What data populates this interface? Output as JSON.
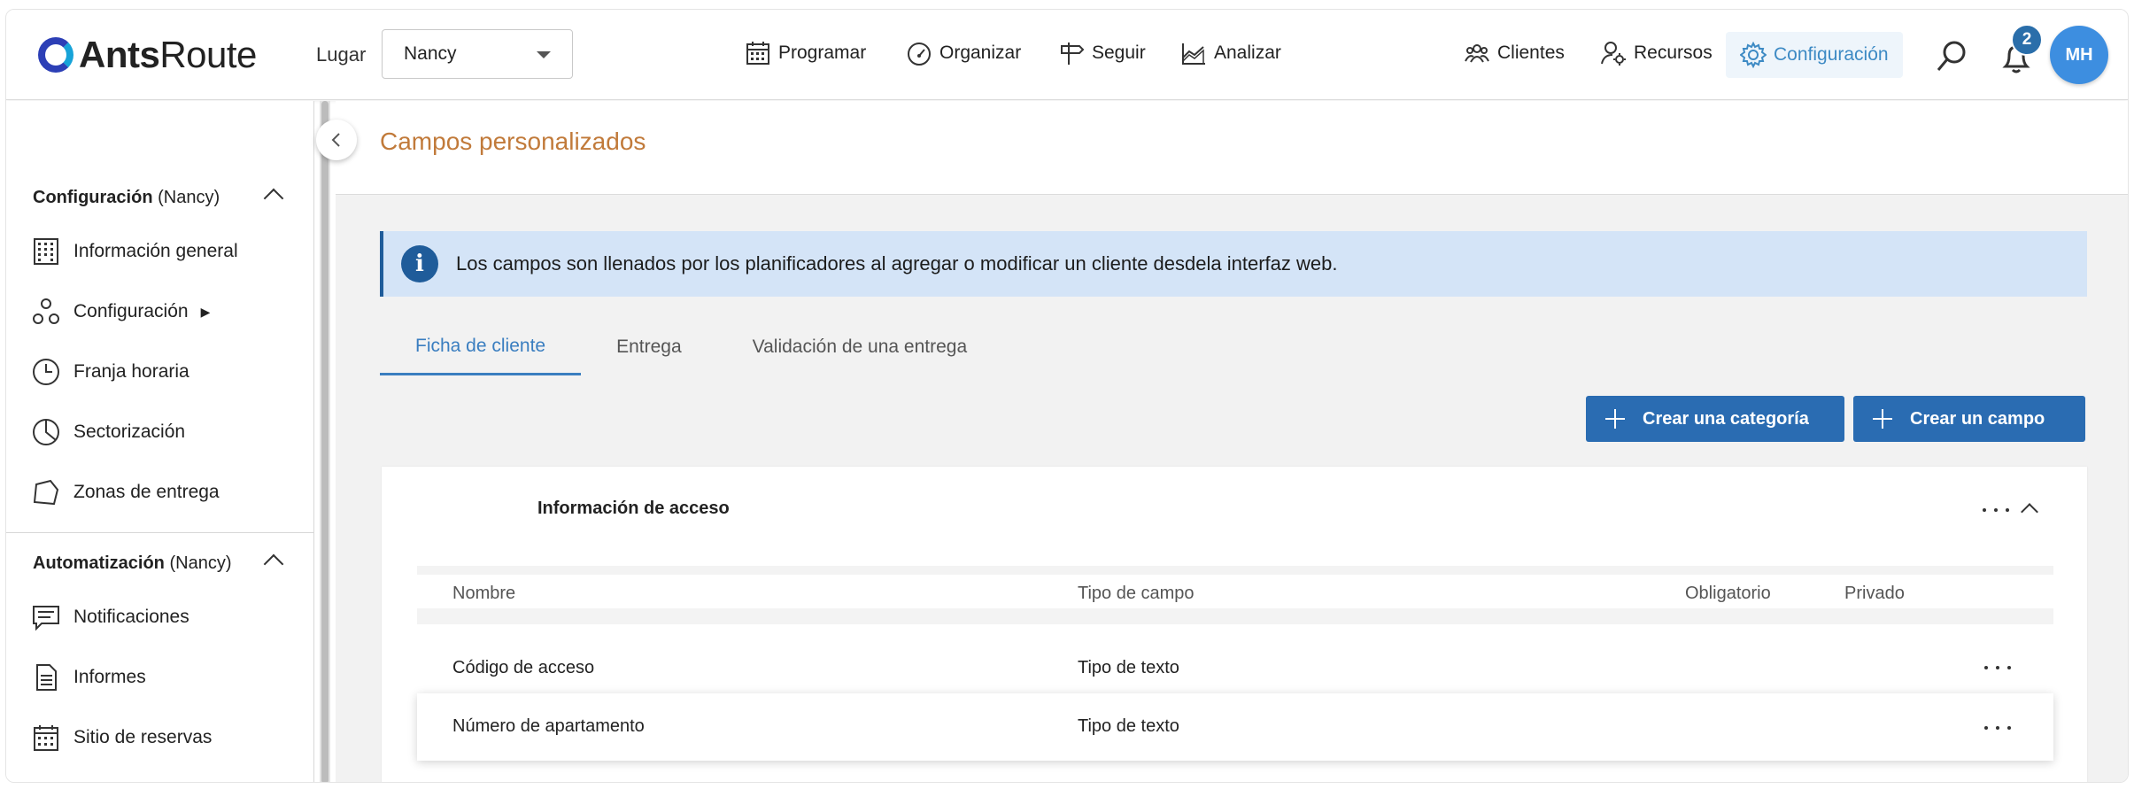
{
  "header": {
    "logo_bold": "Ants",
    "logo_regular": "Route",
    "lugar_label": "Lugar",
    "lugar_value": "Nancy",
    "nav": [
      {
        "label": "Programar",
        "icon": "calendar-icon"
      },
      {
        "label": "Organizar",
        "icon": "gauge-icon"
      },
      {
        "label": "Seguir",
        "icon": "signpost-icon"
      },
      {
        "label": "Analizar",
        "icon": "chart-icon"
      }
    ],
    "right_nav": [
      {
        "label": "Clientes",
        "icon": "users-icon"
      },
      {
        "label": "Recursos",
        "icon": "user-gear-icon"
      },
      {
        "label": "Configuración",
        "icon": "gear-icon",
        "active": true
      }
    ],
    "notifications_count": "2",
    "avatar_initials": "MH"
  },
  "sidebar": {
    "section1": {
      "title": "Configuración",
      "suffix": "(Nancy)"
    },
    "items1": [
      {
        "label": "Información general",
        "icon": "building-icon"
      },
      {
        "label": "Configuración",
        "icon": "cog-cluster-icon",
        "arrow": "▶"
      },
      {
        "label": "Franja horaria",
        "icon": "clock-icon"
      },
      {
        "label": "Sectorización",
        "icon": "pie-icon"
      },
      {
        "label": "Zonas de entrega",
        "icon": "polygon-icon"
      }
    ],
    "section2": {
      "title": "Automatización",
      "suffix": "(Nancy)"
    },
    "items2": [
      {
        "label": "Notificaciones",
        "icon": "message-icon"
      },
      {
        "label": "Informes",
        "icon": "document-icon"
      },
      {
        "label": "Sitio de reservas",
        "icon": "calendar-grid-icon"
      }
    ]
  },
  "main": {
    "title": "Campos personalizados",
    "info_icon": "i",
    "info_text": "Los campos son llenados por los planificadores al agregar o modificar un cliente desdela interfaz web.",
    "tabs": [
      "Ficha de cliente",
      "Entrega",
      "Validación de una entrega"
    ],
    "active_tab": 0,
    "btn_category": "Crear una categoría",
    "btn_field": "Crear un campo",
    "card_title": "Información de acceso",
    "columns": [
      "Nombre",
      "Tipo de campo",
      "Obligatorio",
      "Privado"
    ],
    "rows": [
      {
        "name": "Código de acceso",
        "type": "Tipo de texto"
      },
      {
        "name": "Número de apartamento",
        "type": "Tipo de texto"
      }
    ]
  },
  "colors": {
    "accent": "#3a7ec0",
    "button": "#2a6cb2",
    "title": "#c17a3a",
    "info_bg": "#d4e4f7"
  }
}
